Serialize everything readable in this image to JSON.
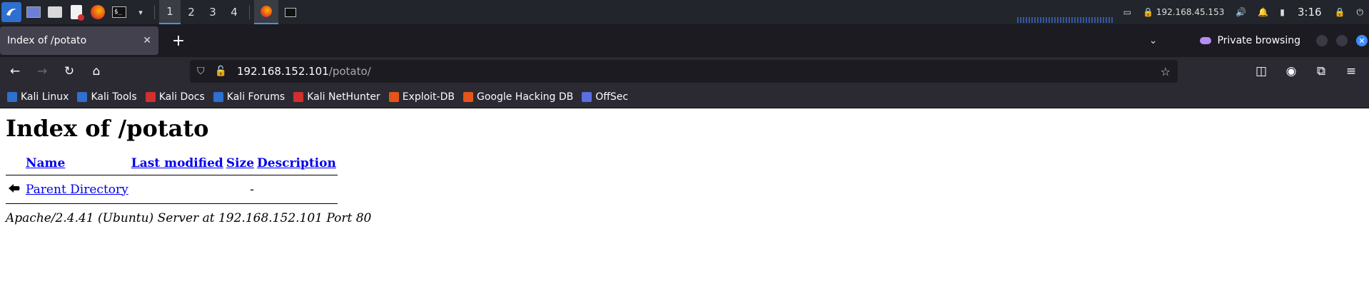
{
  "panel": {
    "workspaces": [
      "1",
      "2",
      "3",
      "4"
    ],
    "active_workspace": "1",
    "network": "192.168.45.153",
    "clock": "3:16"
  },
  "tabs": [
    {
      "title": "Index of /potato",
      "active": true
    }
  ],
  "private_browsing_label": "Private browsing",
  "urlbar": {
    "host": "192.168.152.101",
    "path": "/potato/"
  },
  "bookmarks": [
    {
      "label": "Kali Linux",
      "color": "#2f6fcf"
    },
    {
      "label": "Kali Tools",
      "color": "#2f6fcf"
    },
    {
      "label": "Kali Docs",
      "color": "#d32f2f"
    },
    {
      "label": "Kali Forums",
      "color": "#2f6fcf"
    },
    {
      "label": "Kali NetHunter",
      "color": "#d32f2f"
    },
    {
      "label": "Exploit-DB",
      "color": "#e6541a"
    },
    {
      "label": "Google Hacking DB",
      "color": "#e6541a"
    },
    {
      "label": "OffSec",
      "color": "#5b6ee1"
    }
  ],
  "page": {
    "heading": "Index of /potato",
    "columns": [
      "Name",
      "Last modified",
      "Size",
      "Description"
    ],
    "rows": [
      {
        "name": "Parent Directory",
        "last_modified": "",
        "size": "-",
        "description": ""
      }
    ],
    "footer": "Apache/2.4.41 (Ubuntu) Server at 192.168.152.101 Port 80"
  }
}
